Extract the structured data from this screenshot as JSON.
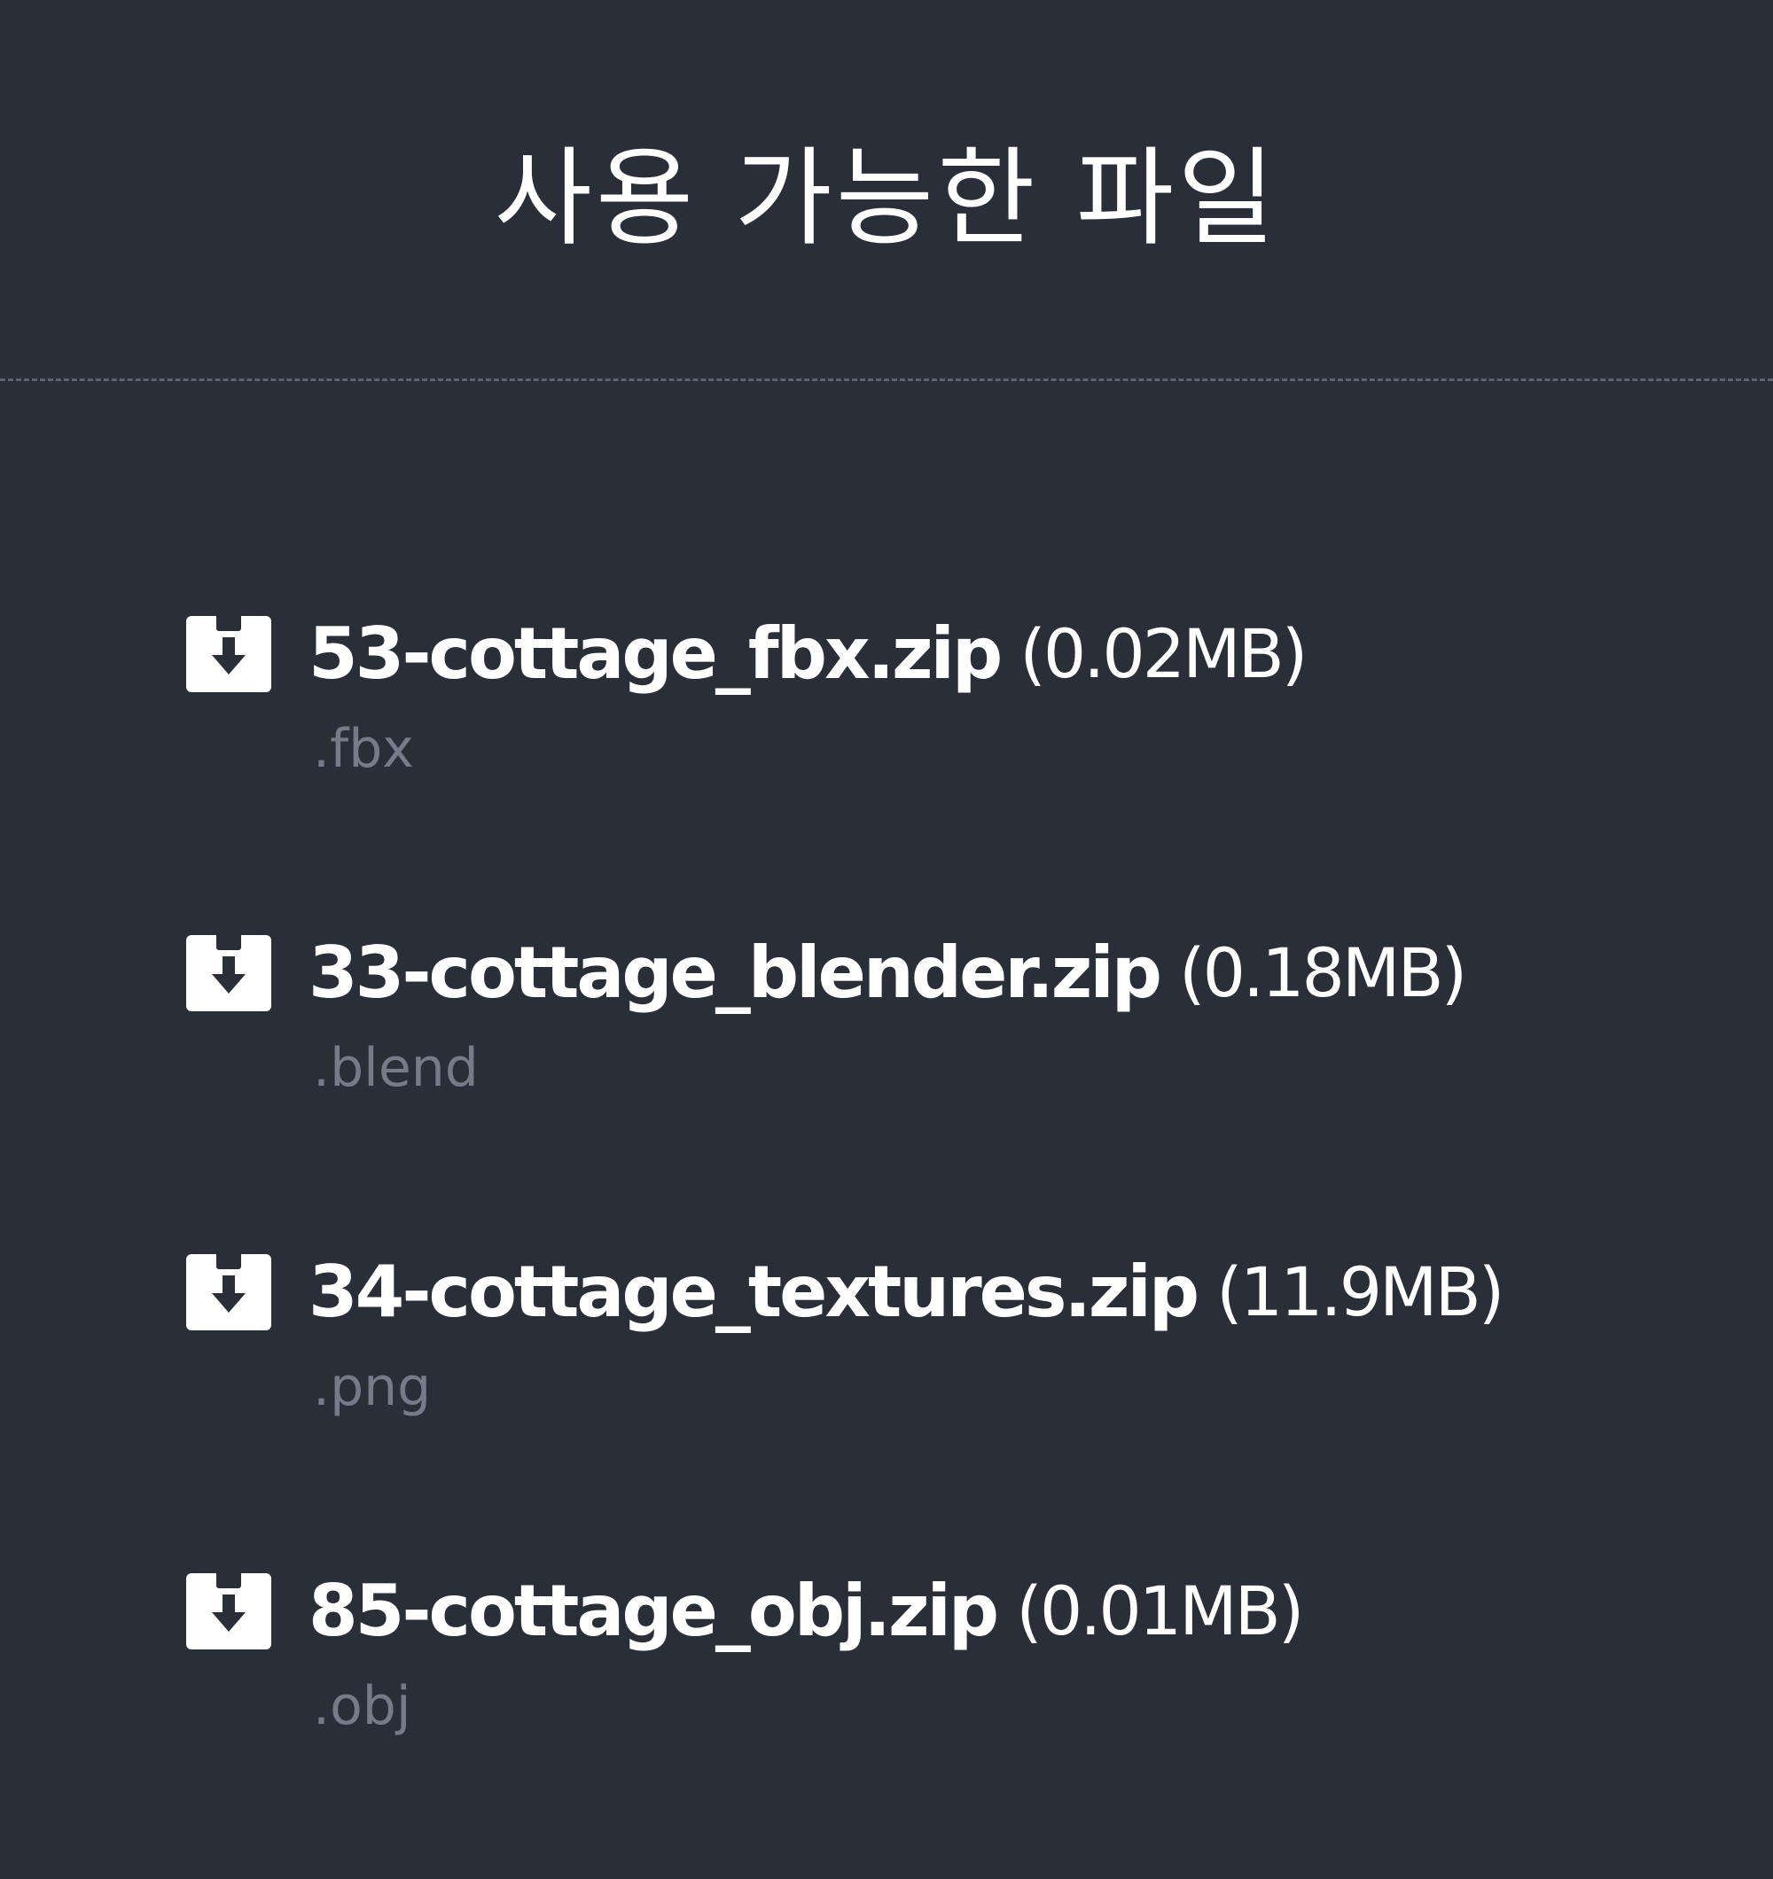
{
  "title": "사용 가능한 파일",
  "files": [
    {
      "name": "53-cottage_fbx.zip",
      "size": "(0.02MB)",
      "ext": ".fbx",
      "icon": "download-icon"
    },
    {
      "name": "33-cottage_blender.zip",
      "size": "(0.18MB)",
      "ext": ".blend",
      "icon": "download-icon"
    },
    {
      "name": "34-cottage_textures.zip",
      "size": "(11.9MB)",
      "ext": ".png",
      "icon": "download-icon"
    },
    {
      "name": "85-cottage_obj.zip",
      "size": "(0.01MB)",
      "ext": ".obj",
      "icon": "download-icon"
    }
  ],
  "colors": {
    "background": "#2a2e37",
    "text": "#ffffff",
    "muted": "#757b87",
    "divider": "#5c6270"
  }
}
